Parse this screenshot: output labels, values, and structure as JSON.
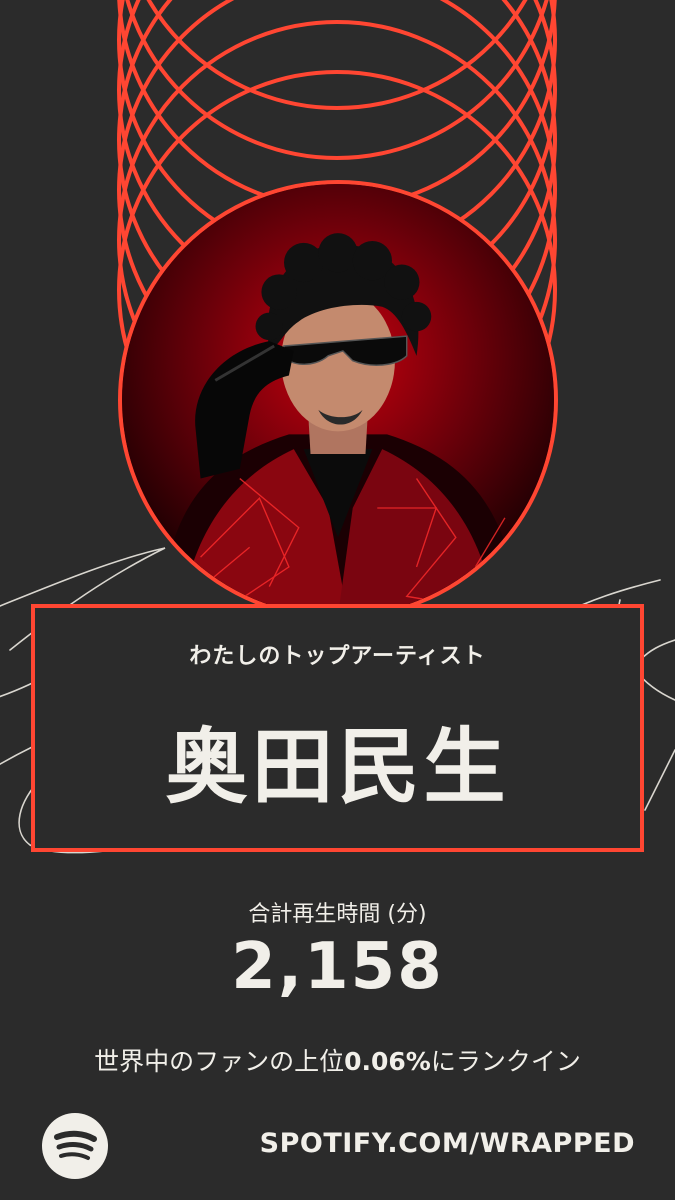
{
  "header": {
    "label": "わたしのトップアーティスト"
  },
  "artist": {
    "name": "奥田民生"
  },
  "stats": {
    "minutes_label": "合計再生時間 (分)",
    "minutes_value": "2,158",
    "rank_prefix": "世界中のファンの上位",
    "rank_percent": "0.06%",
    "rank_suffix": "にランクイン"
  },
  "footer": {
    "url": "SPOTIFY.COM/WRAPPED",
    "logo_icon": "spotify-icon"
  },
  "colors": {
    "background": "#2b2b2b",
    "accent": "#ff4632",
    "text": "#f1efe9"
  }
}
